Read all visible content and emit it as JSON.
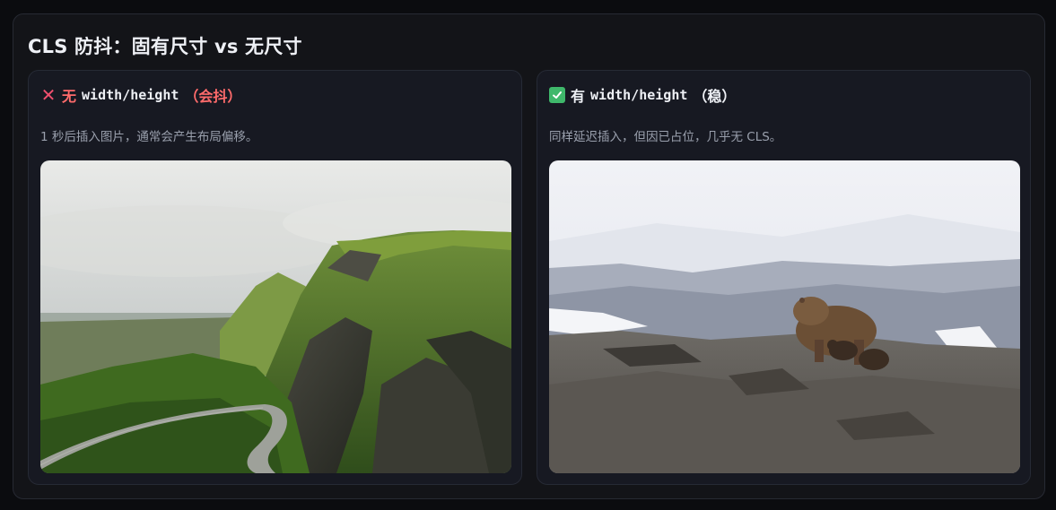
{
  "page": {
    "title": "CLS 防抖：固有尺寸 vs 无尺寸"
  },
  "cards": [
    {
      "status_icon": "cross-mark-icon",
      "title_prefix": "无",
      "title_code": "width/height",
      "title_suffix": "（会抖）",
      "description": "1 秒后插入图片，通常会产生布局偏移。",
      "image_subject": "green-mountain-ridge-with-road",
      "accent_color": "#ff6b6b"
    },
    {
      "status_icon": "check-mark-icon",
      "title_prefix": "有",
      "title_code": "width/height",
      "title_suffix": "（稳）",
      "description": "同样延迟插入，但因已占位，几乎无 CLS。",
      "image_subject": "bear-with-cubs-on-rocks",
      "accent_color": "#3fb86b"
    }
  ]
}
